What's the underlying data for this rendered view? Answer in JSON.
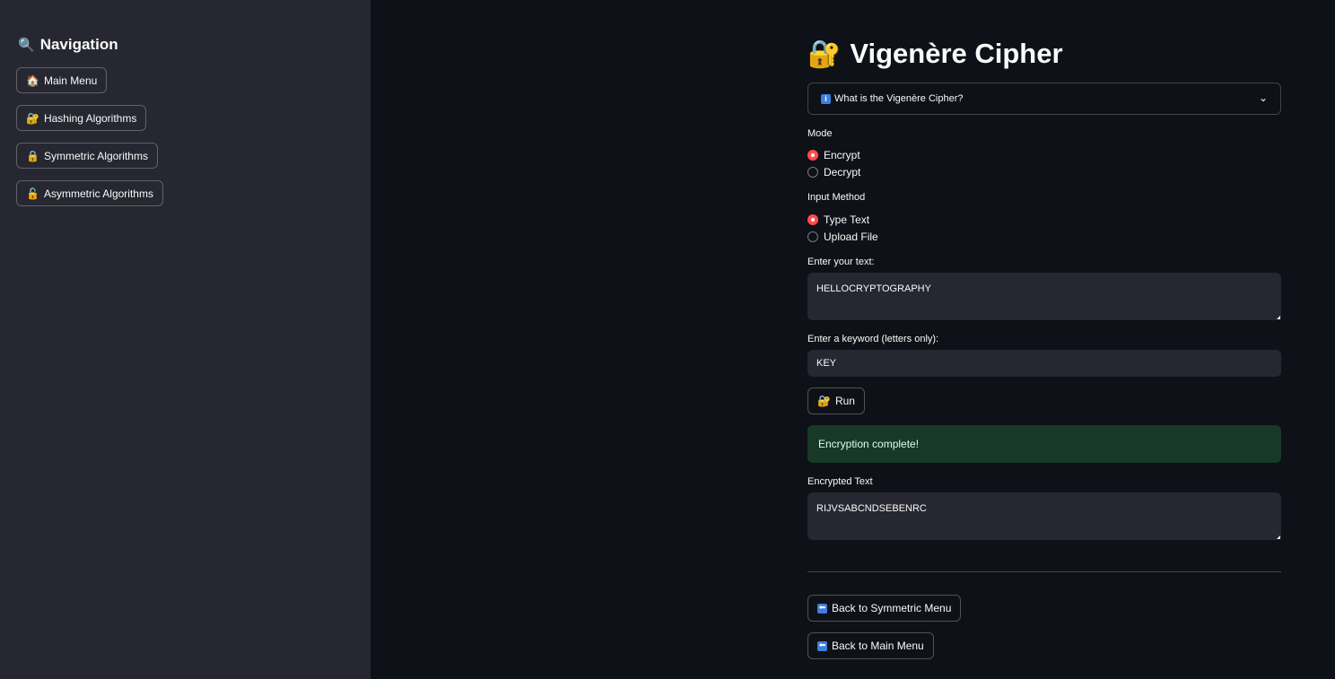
{
  "sidebar": {
    "title": "Navigation",
    "title_icon": "🔍",
    "items": [
      {
        "icon": "🏠",
        "label": "Main Menu"
      },
      {
        "icon": "🔐",
        "label": "Hashing Algorithms"
      },
      {
        "icon": "🔒",
        "label": "Symmetric Algorithms"
      },
      {
        "icon": "🔓",
        "label": "Asymmetric Algorithms"
      }
    ]
  },
  "main": {
    "title": "Vigenère Cipher",
    "title_icon": "🔐",
    "expander": {
      "icon": "i",
      "label": "What is the Vigenère Cipher?",
      "chevron": "⌄"
    },
    "mode": {
      "label": "Mode",
      "options": [
        "Encrypt",
        "Decrypt"
      ],
      "selected": "Encrypt"
    },
    "input_method": {
      "label": "Input Method",
      "options": [
        "Type Text",
        "Upload File"
      ],
      "selected": "Type Text"
    },
    "text_input": {
      "label": "Enter your text:",
      "value": "HELLOCRYPTOGRAPHY"
    },
    "keyword_input": {
      "label": "Enter a keyword (letters only):",
      "value": "KEY"
    },
    "run_button": {
      "icon": "🔐",
      "label": "Run"
    },
    "success_message": "Encryption complete!",
    "output": {
      "label": "Encrypted Text",
      "value": "RIJVSABCNDSEBENRC"
    },
    "back_symmetric": {
      "icon": "⬅",
      "label": "Back to Symmetric Menu"
    },
    "back_main": {
      "icon": "⬅",
      "label": "Back to Main Menu"
    }
  },
  "colors": {
    "background": "#0e1117",
    "sidebar": "#262730",
    "accent": "#ff4b4b",
    "success_bg": "#173928",
    "input_bg": "#262730"
  }
}
